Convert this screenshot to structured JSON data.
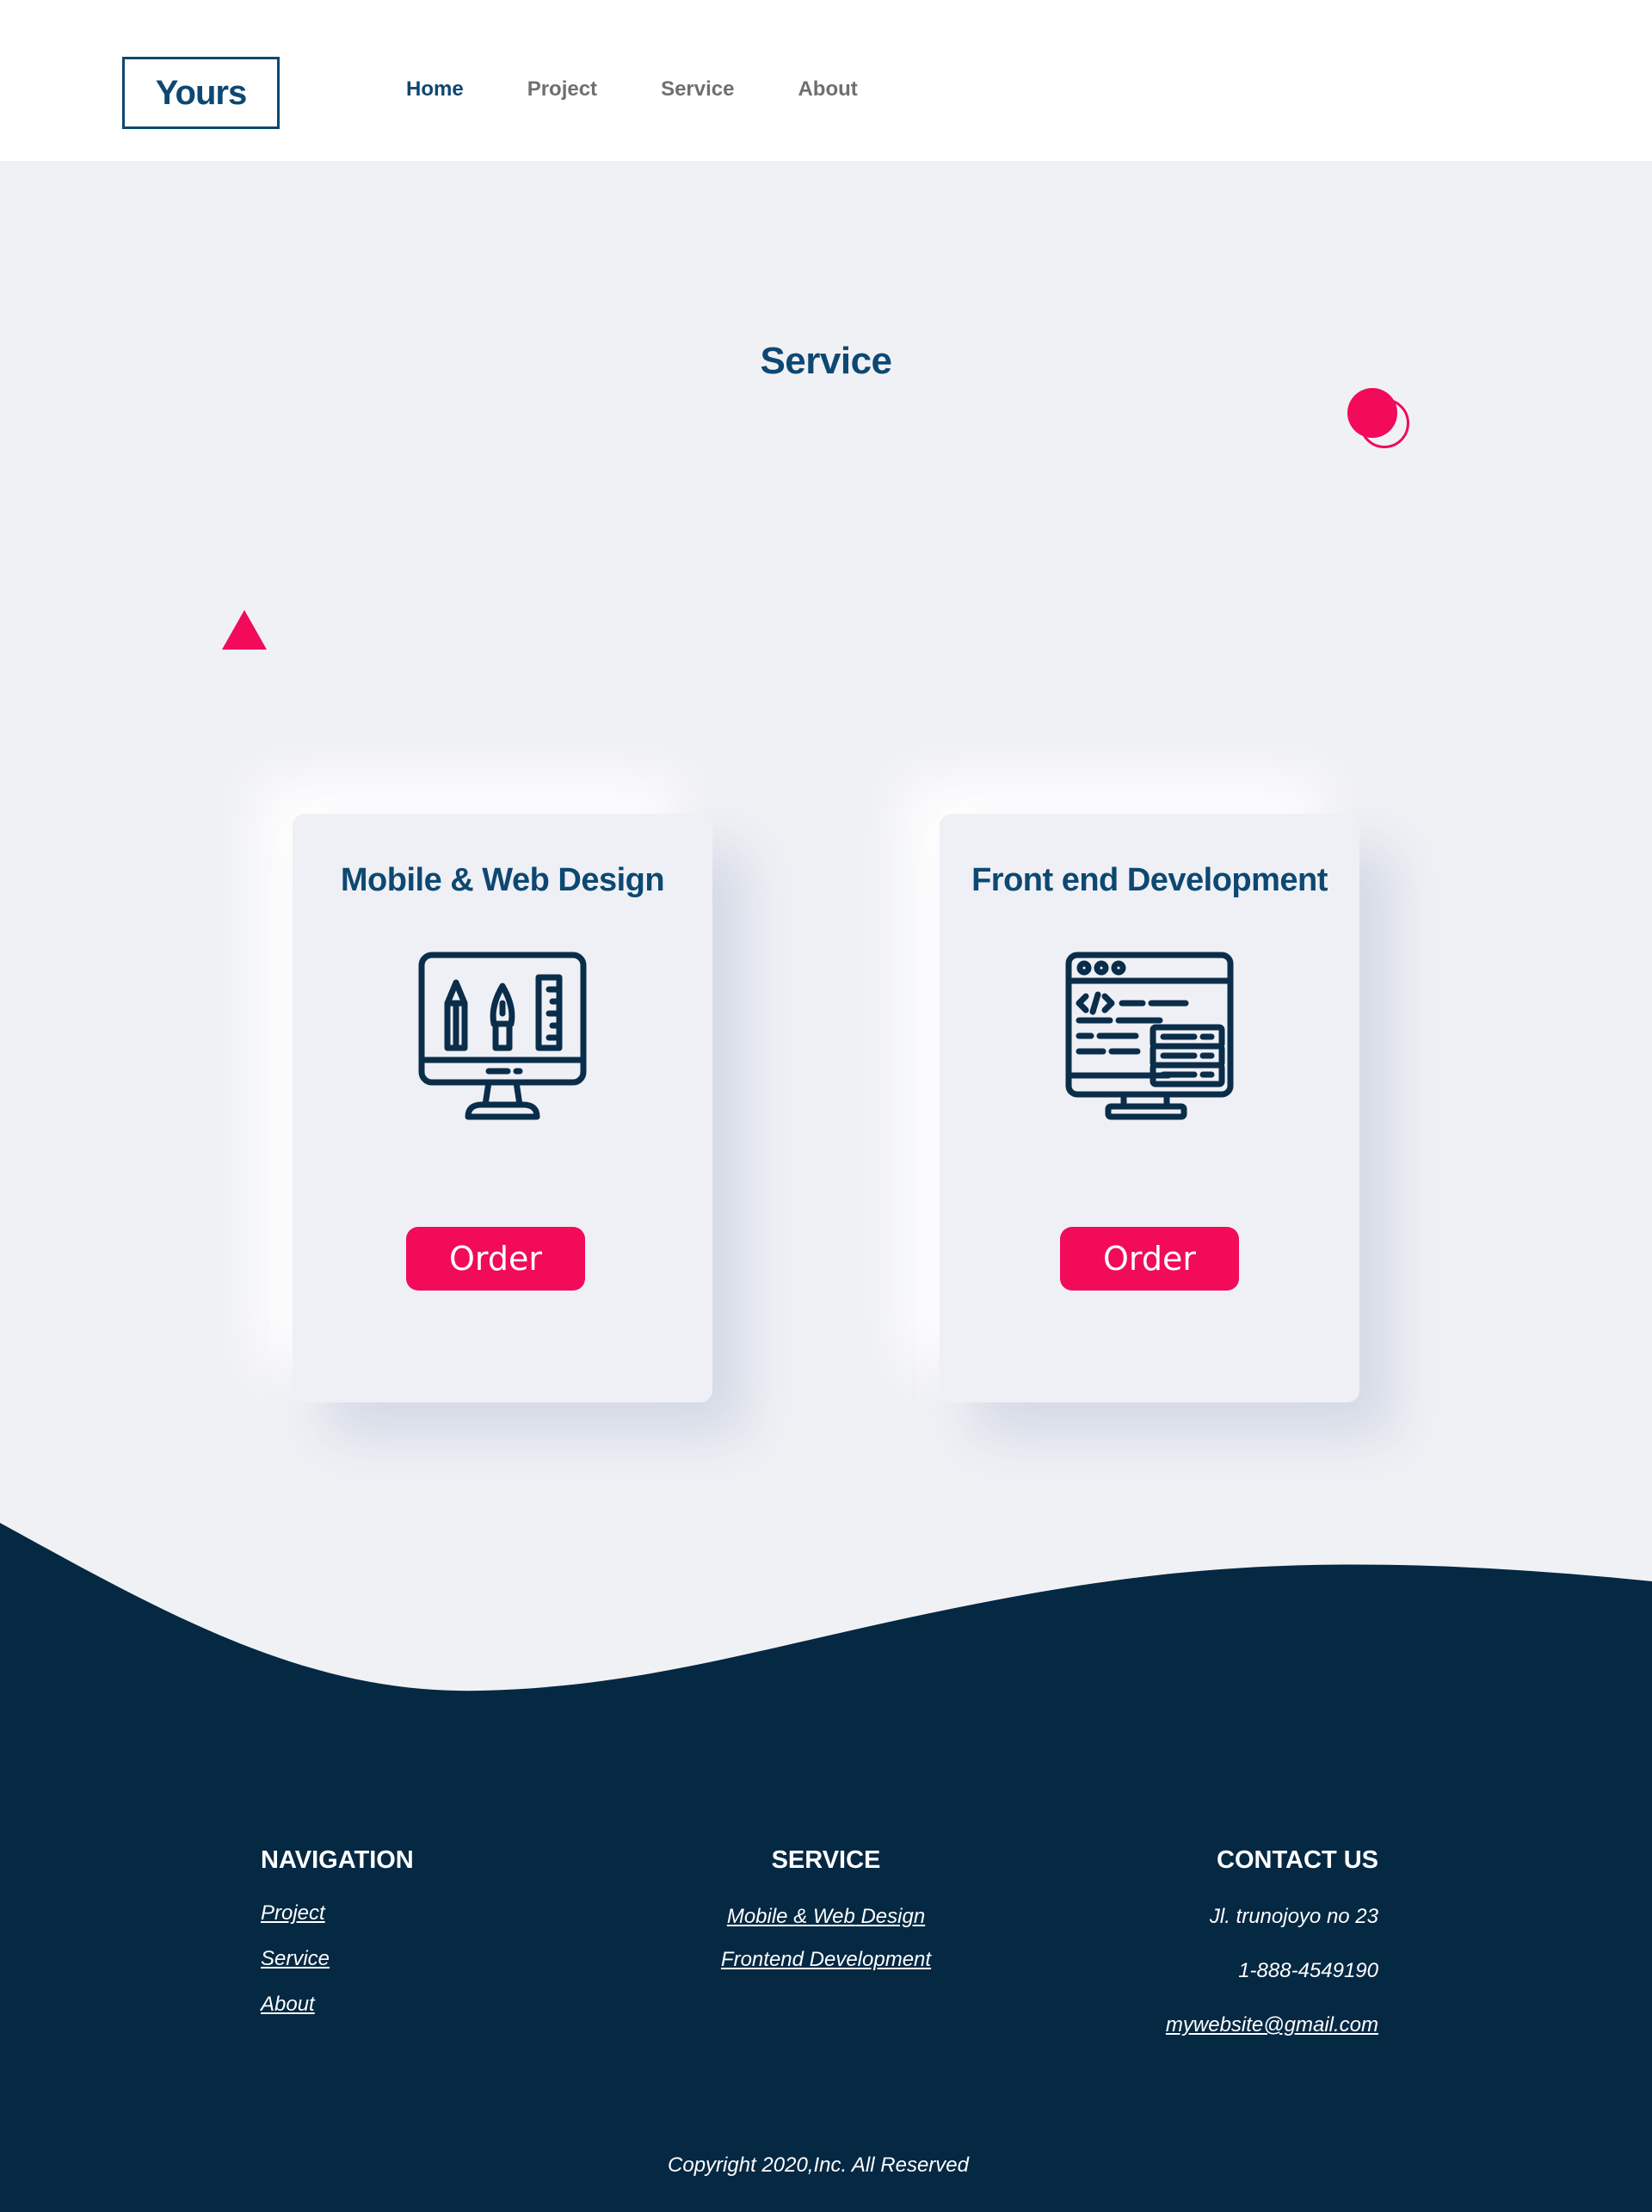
{
  "header": {
    "logo": "Yours",
    "nav": [
      {
        "label": "Home",
        "active": true
      },
      {
        "label": "Project",
        "active": false
      },
      {
        "label": "Service",
        "active": false
      },
      {
        "label": "About",
        "active": false
      }
    ]
  },
  "main": {
    "title": "Service",
    "cards": [
      {
        "title": "Mobile & Web Design",
        "icon": "design-monitor-icon",
        "button": "Order"
      },
      {
        "title": "Front end Development",
        "icon": "code-monitor-icon",
        "button": "Order"
      }
    ]
  },
  "footer": {
    "navigation": {
      "heading": "NAVIGATION",
      "items": [
        "Project",
        "Service",
        "About"
      ]
    },
    "service": {
      "heading": "SERVICE",
      "items": [
        "Mobile & Web Design",
        "Frontend Development"
      ]
    },
    "contact": {
      "heading": "CONTACT US",
      "items": [
        "Jl. trunojoyo no 23",
        "1-888-4549190",
        "mywebsite@gmail.com"
      ]
    },
    "copyright": "Copyright 2020,Inc. All Reserved"
  },
  "colors": {
    "primary": "#0d4872",
    "accent": "#f10b59",
    "background": "#f0f1f5",
    "footer": "#052843"
  }
}
